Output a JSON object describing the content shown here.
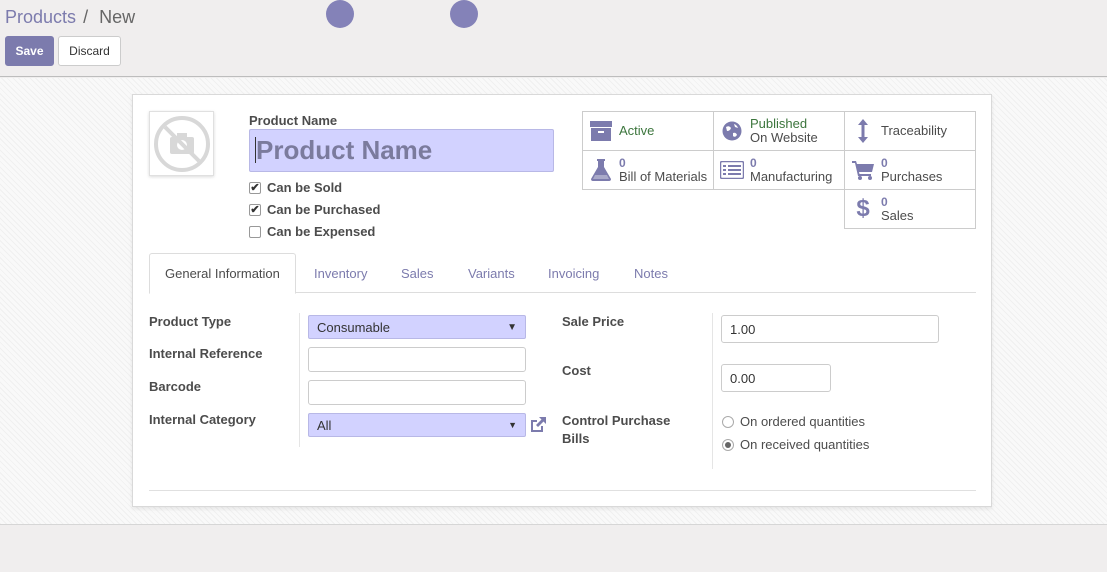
{
  "breadcrumb": {
    "parent": "Products",
    "separator": "/",
    "current": "New"
  },
  "toolbar": {
    "save_label": "Save",
    "discard_label": "Discard"
  },
  "product": {
    "name_label": "Product Name",
    "name_placeholder": "Product Name",
    "name_value": "",
    "checkboxes": [
      {
        "label": "Can be Sold",
        "checked": true
      },
      {
        "label": "Can be Purchased",
        "checked": true
      },
      {
        "label": "Can be Expensed",
        "checked": false
      }
    ]
  },
  "smart_buttons": {
    "active": {
      "label": "Active",
      "icon": "archive-icon"
    },
    "published": {
      "line1": "Published",
      "line2": "On Website",
      "icon": "globe-icon"
    },
    "traceability": {
      "label": "Traceability",
      "icon": "arrows-vertical-icon"
    },
    "bom": {
      "value": "0",
      "label": "Bill of Materials",
      "icon": "flask-icon"
    },
    "manufacturing": {
      "value": "0",
      "label": "Manufacturing",
      "icon": "list-alt-icon"
    },
    "purchases": {
      "value": "0",
      "label": "Purchases",
      "icon": "cart-icon"
    },
    "sales": {
      "value": "0",
      "label": "Sales",
      "icon": "dollar-icon"
    }
  },
  "tabs": [
    {
      "label": "General Information",
      "active": true
    },
    {
      "label": "Inventory",
      "active": false
    },
    {
      "label": "Sales",
      "active": false
    },
    {
      "label": "Variants",
      "active": false
    },
    {
      "label": "Invoicing",
      "active": false
    },
    {
      "label": "Notes",
      "active": false
    }
  ],
  "general": {
    "product_type_label": "Product Type",
    "product_type_value": "Consumable",
    "internal_ref_label": "Internal Reference",
    "internal_ref_value": "",
    "barcode_label": "Barcode",
    "barcode_value": "",
    "category_label": "Internal Category",
    "category_value": "All",
    "sale_price_label": "Sale Price",
    "sale_price_value": "1.00",
    "cost_label": "Cost",
    "cost_value": "0.00",
    "control_label_line1": "Control Purchase",
    "control_label_line2": "Bills",
    "control_options": [
      {
        "label": "On ordered quantities",
        "selected": false
      },
      {
        "label": "On received quantities",
        "selected": true
      }
    ]
  },
  "colors": {
    "accent": "#7c7bad",
    "required_field": "#d2d2ff",
    "published_green": "#3c763d"
  }
}
